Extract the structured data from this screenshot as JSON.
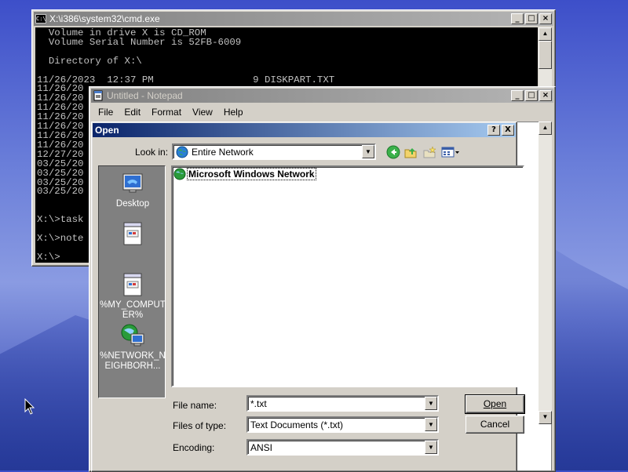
{
  "cmd": {
    "title": "X:\\i386\\system32\\cmd.exe",
    "lines": [
      "  Volume in drive X is CD_ROM",
      "  Volume Serial Number is 52FB-6009",
      "",
      "  Directory of X:\\",
      "",
      "11/26/2023  12:37 PM                 9 DISKPART.TXT",
      "11/26/20",
      "11/26/20",
      "11/26/20",
      "11/26/20",
      "11/26/20",
      "11/26/20",
      "11/26/20",
      "12/27/20",
      "03/25/20",
      "03/25/20",
      "03/25/20",
      "03/25/20",
      "",
      "",
      "X:\\>task",
      "",
      "X:\\>note",
      "",
      "X:\\>"
    ]
  },
  "notepad": {
    "title": "Untitled - Notepad",
    "menu": [
      "File",
      "Edit",
      "Format",
      "View",
      "Help"
    ]
  },
  "open_dialog": {
    "title": "Open",
    "help_btn": "?",
    "close_btn": "X",
    "look_in_label": "Look in:",
    "look_in_value": "Entire Network",
    "places": {
      "desktop": "Desktop",
      "my_computer": "%MY_COMPUTER%",
      "network": "%NETWORK_NEIGHBORH..."
    },
    "file_items": [
      "Microsoft Windows Network"
    ],
    "file_name_label": "File name:",
    "file_name_value": "*.txt",
    "files_of_type_label": "Files of type:",
    "files_of_type_value": "Text Documents (*.txt)",
    "encoding_label": "Encoding:",
    "encoding_value": "ANSI",
    "open_btn": "Open",
    "cancel_btn": "Cancel"
  },
  "colors": {
    "active_title": "#0a246a",
    "inactive_title": "#808080",
    "face": "#d4d0c8"
  }
}
